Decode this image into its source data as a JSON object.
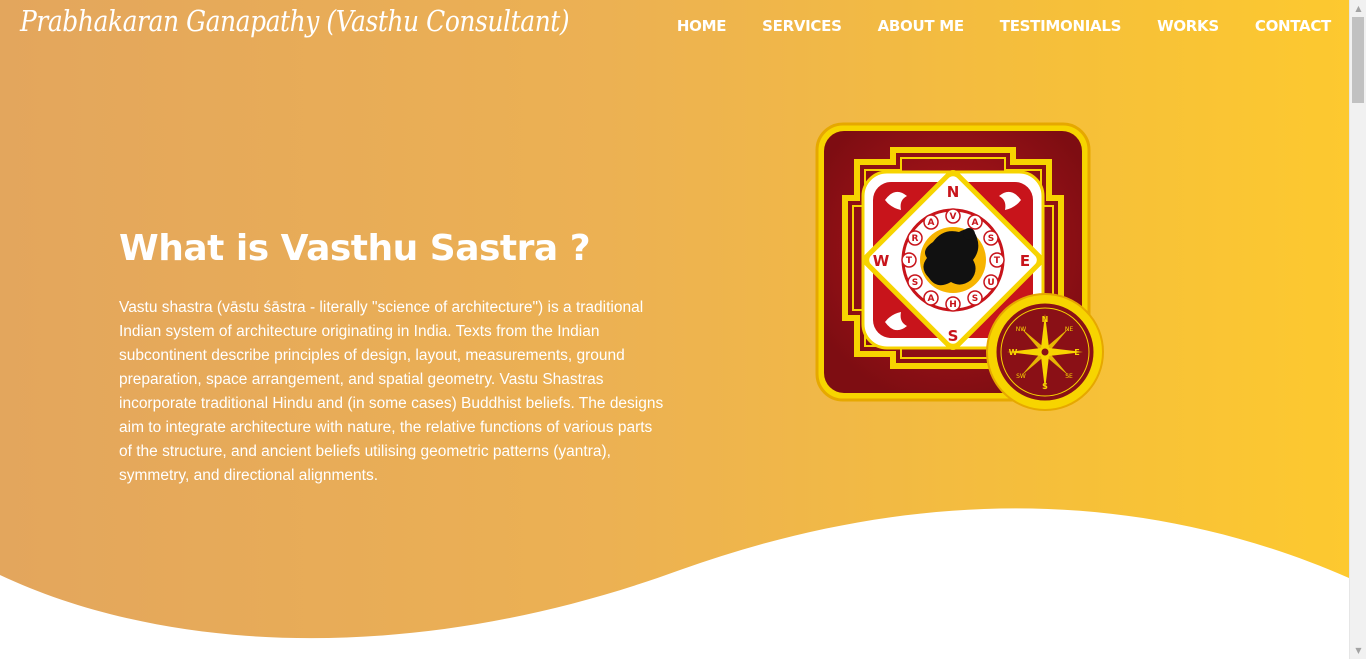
{
  "brand": "Prabhakaran Ganapathy (Vasthu Consultant)",
  "nav": {
    "items": [
      "HOME",
      "SERVICES",
      "ABOUT ME",
      "TESTIMONIALS",
      "WORKS",
      "CONTACT"
    ]
  },
  "hero": {
    "title": "What is Vasthu Sastra ?",
    "description": "Vastu shastra (vāstu śāstra - literally \"science of architecture\") is a traditional Indian system of architecture originating in India. Texts from the Indian subcontinent describe principles of design, layout, measurements, ground preparation, space arrangement, and spatial geometry. Vastu Shastras incorporate traditional Hindu and (in some cases) Buddhist beliefs. The designs aim to integrate architecture with nature, the relative functions of various parts of the structure, and ancient beliefs utilising geometric patterns (yantra), symmetry, and directional alignments."
  },
  "illustration": {
    "directions": [
      "N",
      "E",
      "S",
      "W"
    ],
    "ring_letters": [
      "V",
      "A",
      "S",
      "T",
      "U",
      "S",
      "H",
      "A",
      "S",
      "T",
      "R",
      "A"
    ],
    "compass": {
      "major": [
        "N",
        "E",
        "S",
        "W"
      ],
      "minor": [
        "NE",
        "SE",
        "SW",
        "NW"
      ]
    }
  },
  "colors": {
    "gradient_start": "#e3a65d",
    "gradient_end": "#fdc92f",
    "yantra_red": "#c8141b",
    "gold": "#f5d300"
  },
  "scrollbar": {
    "up_icon": "▲",
    "down_icon": "▼"
  }
}
